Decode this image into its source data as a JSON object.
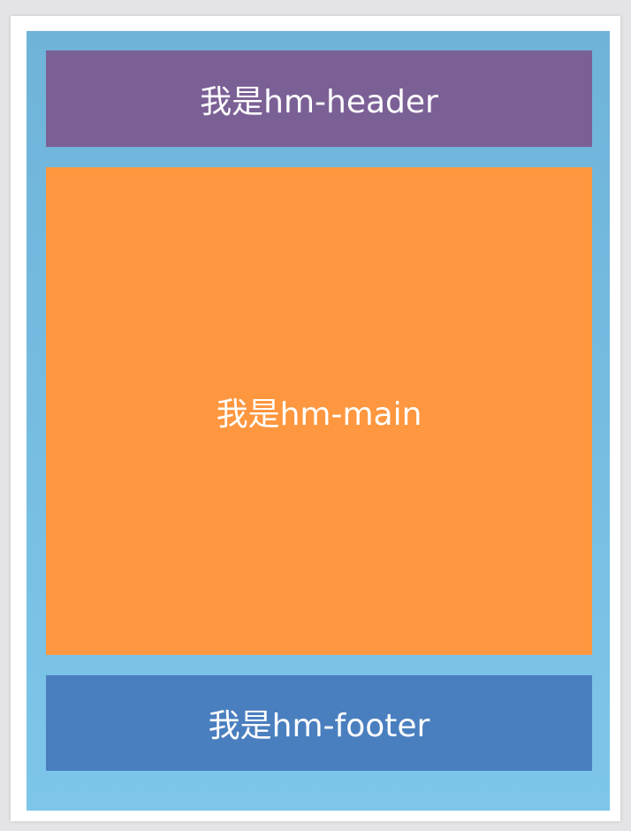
{
  "layout": {
    "header": {
      "label": "我是hm-header",
      "color": "#7b6096"
    },
    "main": {
      "label": "我是hm-main",
      "color": "#fe973f"
    },
    "footer": {
      "label": "我是hm-footer",
      "color": "#4a7fbf"
    },
    "container_color": "#78bee4"
  }
}
